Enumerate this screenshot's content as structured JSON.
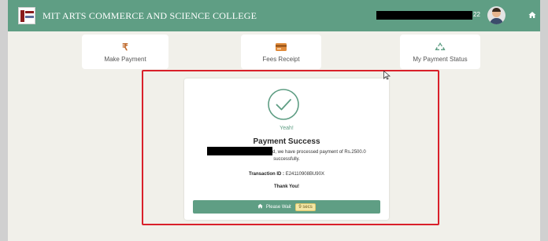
{
  "header": {
    "college_name": "MIT ARTS COMMERCE AND SCIENCE COLLEGE",
    "user_suffix": "22",
    "bg_color": "#5f9e84"
  },
  "nav": {
    "make_payment": {
      "label": "Make Payment",
      "icon": "rupee-icon",
      "symbol": "₹"
    },
    "fees_receipt": {
      "label": "Fees Receipt",
      "icon": "credit-card-icon"
    },
    "payment_status": {
      "label": "My Payment Status",
      "icon": "recycle-icon"
    }
  },
  "modal": {
    "yeah": "Yeah!",
    "title": "Payment Success",
    "message_line1": "d, we have processed payment of Rs.2500.0",
    "message_line2": "successfully.",
    "transaction_label": "Transaction ID :",
    "transaction_id": "E24110908BU90X",
    "thanks": "Thank You!",
    "wait_text": "Please Wait",
    "wait_secs": "9 secs",
    "accent_color": "#5f9e84"
  }
}
